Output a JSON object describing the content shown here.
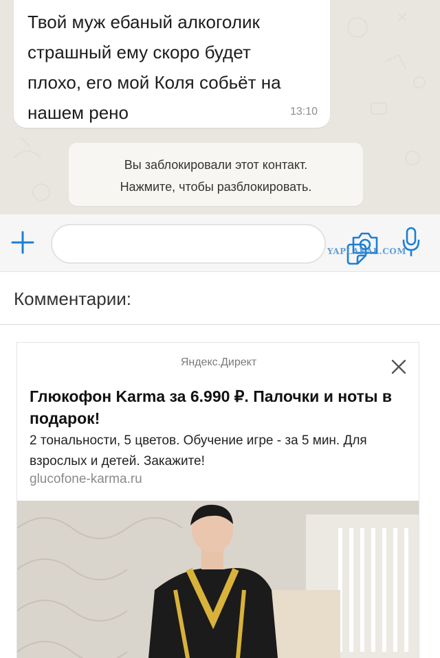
{
  "chat": {
    "message_text": "Твой муж ебаный алкоголик\nстрашный ему скоро будет\nплохо, его мой Коля собьёт на\nнашем рено",
    "message_time": "13:10",
    "system_line1": "Вы заблокировали этот контакт.",
    "system_line2": "Нажмите, чтобы разблокировать.",
    "background_color": "#e9e6df"
  },
  "inputbar": {
    "icons": [
      "plus-icon",
      "sticker-icon",
      "camera-icon",
      "microphone-icon"
    ],
    "accent_color": "#1a7fd6"
  },
  "watermark": "YAPLAKAL.COM",
  "comments": {
    "title": "Комментарии:"
  },
  "ad": {
    "source": "Яндекс.Директ",
    "title": "Глюкофон Karma за 6.990 ₽. Палочки и ноты в подарок!",
    "description": "2 тональности, 5 цветов. Обучение игре - за 5 мин. Для взрослых и детей. Закажите!",
    "url": "glucofone-karma.ru",
    "close_icon": "close-icon"
  }
}
